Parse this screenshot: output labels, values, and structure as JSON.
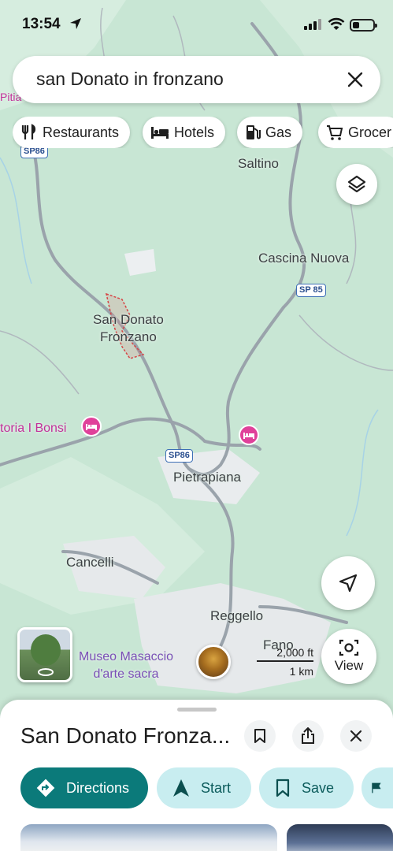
{
  "status_bar": {
    "time": "13:54"
  },
  "search": {
    "query": "san Donato in fronzano"
  },
  "chips": [
    {
      "label": "Restaurants",
      "icon": "fork-knife-icon"
    },
    {
      "label": "Hotels",
      "icon": "bed-icon"
    },
    {
      "label": "Gas",
      "icon": "gas-pump-icon"
    },
    {
      "label": "Grocer",
      "icon": "cart-icon"
    }
  ],
  "map": {
    "places": {
      "saltino": "Saltino",
      "cascina_nuova": "Cascina Nuova",
      "san_donato_line1": "San Donato",
      "san_donato_line2": "Fronzano",
      "bonsi": "toria I Bonsi",
      "pietrapiana": "Pietrapiana",
      "cancelli": "Cancelli",
      "reggello": "Reggello",
      "fano": "Fano",
      "museo_line1": "Museo Masaccio",
      "museo_line2": "d'arte sacra",
      "pitia": "Pitia"
    },
    "roads": {
      "sp86_top": "SP86",
      "sp85": "SP 85",
      "sp86_mid": "SP86"
    },
    "scale": {
      "feet": "2,000 ft",
      "km": "1 km"
    },
    "view_label": "View"
  },
  "sheet": {
    "title": "San Donato Fronza...",
    "actions": {
      "directions": "Directions",
      "start": "Start",
      "save": "Save"
    }
  },
  "colors": {
    "map_bg": "#c8e6d4",
    "primary_button": "#0b7a7a",
    "secondary_button": "#c8edf0",
    "hotel_pin": "#e0409a"
  }
}
